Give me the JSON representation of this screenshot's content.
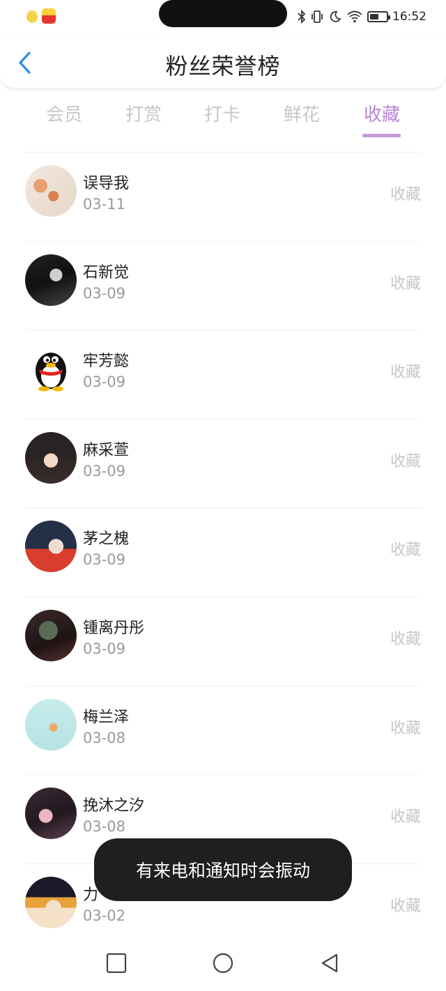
{
  "status": {
    "time": "16:52",
    "battery_level": 0.55,
    "icons": [
      "bluetooth-icon",
      "vibrate-icon",
      "moon-icon",
      "wifi-icon",
      "battery-icon"
    ]
  },
  "header": {
    "title": "粉丝荣誉榜",
    "back_icon": "chevron-left-icon"
  },
  "tabs": [
    {
      "label": "会员"
    },
    {
      "label": "打赏"
    },
    {
      "label": "打卡"
    },
    {
      "label": "鲜花"
    },
    {
      "label": "收藏",
      "active": true
    }
  ],
  "colors": {
    "accent": "#b985d6",
    "back": "#2a8fe8",
    "muted": "#c7c7c7",
    "toast_bg": "#1f1f1f"
  },
  "list": [
    {
      "name": "误导我",
      "date": "03-11",
      "action": "收藏"
    },
    {
      "name": "石新觉",
      "date": "03-09",
      "action": "收藏"
    },
    {
      "name": "牢芳懿",
      "date": "03-09",
      "action": "收藏"
    },
    {
      "name": "麻采萱",
      "date": "03-09",
      "action": "收藏"
    },
    {
      "name": "茅之槐",
      "date": "03-09",
      "action": "收藏"
    },
    {
      "name": "锺离丹彤",
      "date": "03-09",
      "action": "收藏"
    },
    {
      "name": "梅兰泽",
      "date": "03-08",
      "action": "收藏"
    },
    {
      "name": "挽沐之汐",
      "date": "03-08",
      "action": "收藏"
    },
    {
      "name": "力",
      "date": "03-02",
      "action": "收藏"
    }
  ],
  "toast": {
    "text": "有来电和通知时会振动"
  },
  "navbar": {
    "icons": [
      "square-icon",
      "circle-icon",
      "triangle-back-icon"
    ]
  }
}
